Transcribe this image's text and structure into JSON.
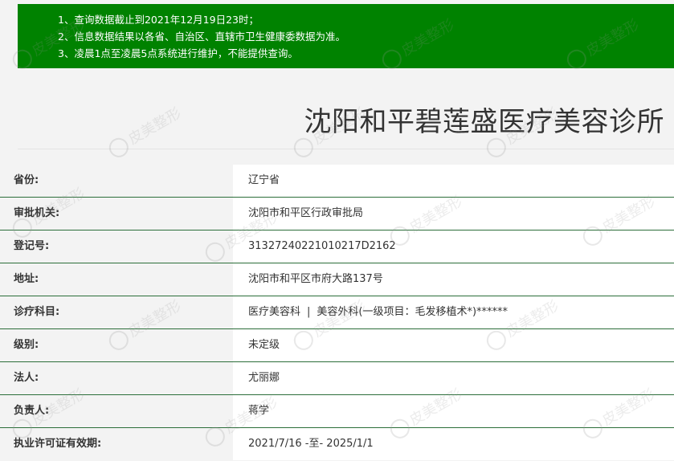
{
  "notice": {
    "lines": [
      "1、查询数据截止到2021年12月19日23时；",
      "2、信息数据结果以各省、自治区、直辖市卫生健康委数据为准。",
      "3、凌晨1点至凌晨5点系统进行维护，不能提供查询。"
    ]
  },
  "page_title": "沈阳和平碧莲盛医疗美容诊所",
  "watermark_text": "皮美整形",
  "rows": [
    {
      "label": "省份:",
      "value": "辽宁省"
    },
    {
      "label": "审批机关:",
      "value": "沈阳市和平区行政审批局"
    },
    {
      "label": "登记号:",
      "value": "31327240221010217D2162"
    },
    {
      "label": "地址:",
      "value": "沈阳市和平区市府大路137号"
    },
    {
      "label": "诊疗科目:",
      "value_parts": [
        "医疗美容科",
        "|",
        "美容外科(一级项目：毛发移植术*)******"
      ]
    },
    {
      "label": "级别:",
      "value": "未定级"
    },
    {
      "label": "法人:",
      "value": "尤丽娜"
    },
    {
      "label": "负责人:",
      "value": "蒋学"
    },
    {
      "label": "执业许可证有效期:",
      "value": "2021/7/16 -至- 2025/1/1"
    }
  ]
}
